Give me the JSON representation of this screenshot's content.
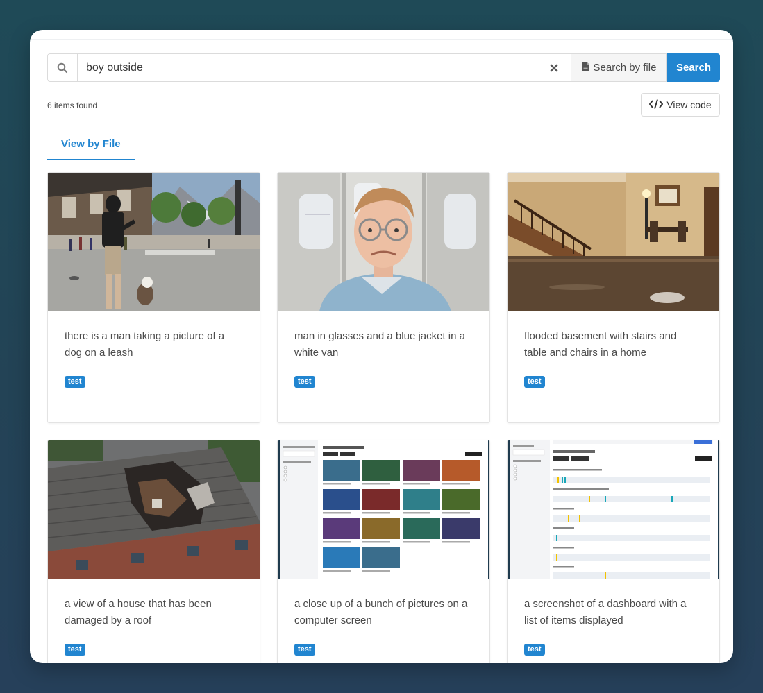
{
  "search": {
    "query": "boy outside",
    "search_by_file_label": "Search by file",
    "search_button_label": "Search"
  },
  "results": {
    "count_text": "6 items found",
    "view_code_label": "View code"
  },
  "tabs": [
    {
      "label": "View by File"
    }
  ],
  "cards": [
    {
      "caption": "there is a man taking a picture of a dog on a leash",
      "tag": "test",
      "image": "street-man-dog"
    },
    {
      "caption": "man in glasses and a blue jacket in a white van",
      "tag": "test",
      "image": "man-in-van"
    },
    {
      "caption": "flooded basement with stairs and table and chairs in a home",
      "tag": "test",
      "image": "flooded-basement"
    },
    {
      "caption": "a view of a house that has been damaged by a roof",
      "tag": "test",
      "image": "damaged-roof"
    },
    {
      "caption": "a close up of a bunch of pictures on a computer screen",
      "tag": "test",
      "image": "screenshot-grid"
    },
    {
      "caption": "a screenshot of a dashboard with a list of items displayed",
      "tag": "test",
      "image": "screenshot-dashboard"
    }
  ],
  "colors": {
    "accent": "#2185d0",
    "background": "#234356"
  }
}
